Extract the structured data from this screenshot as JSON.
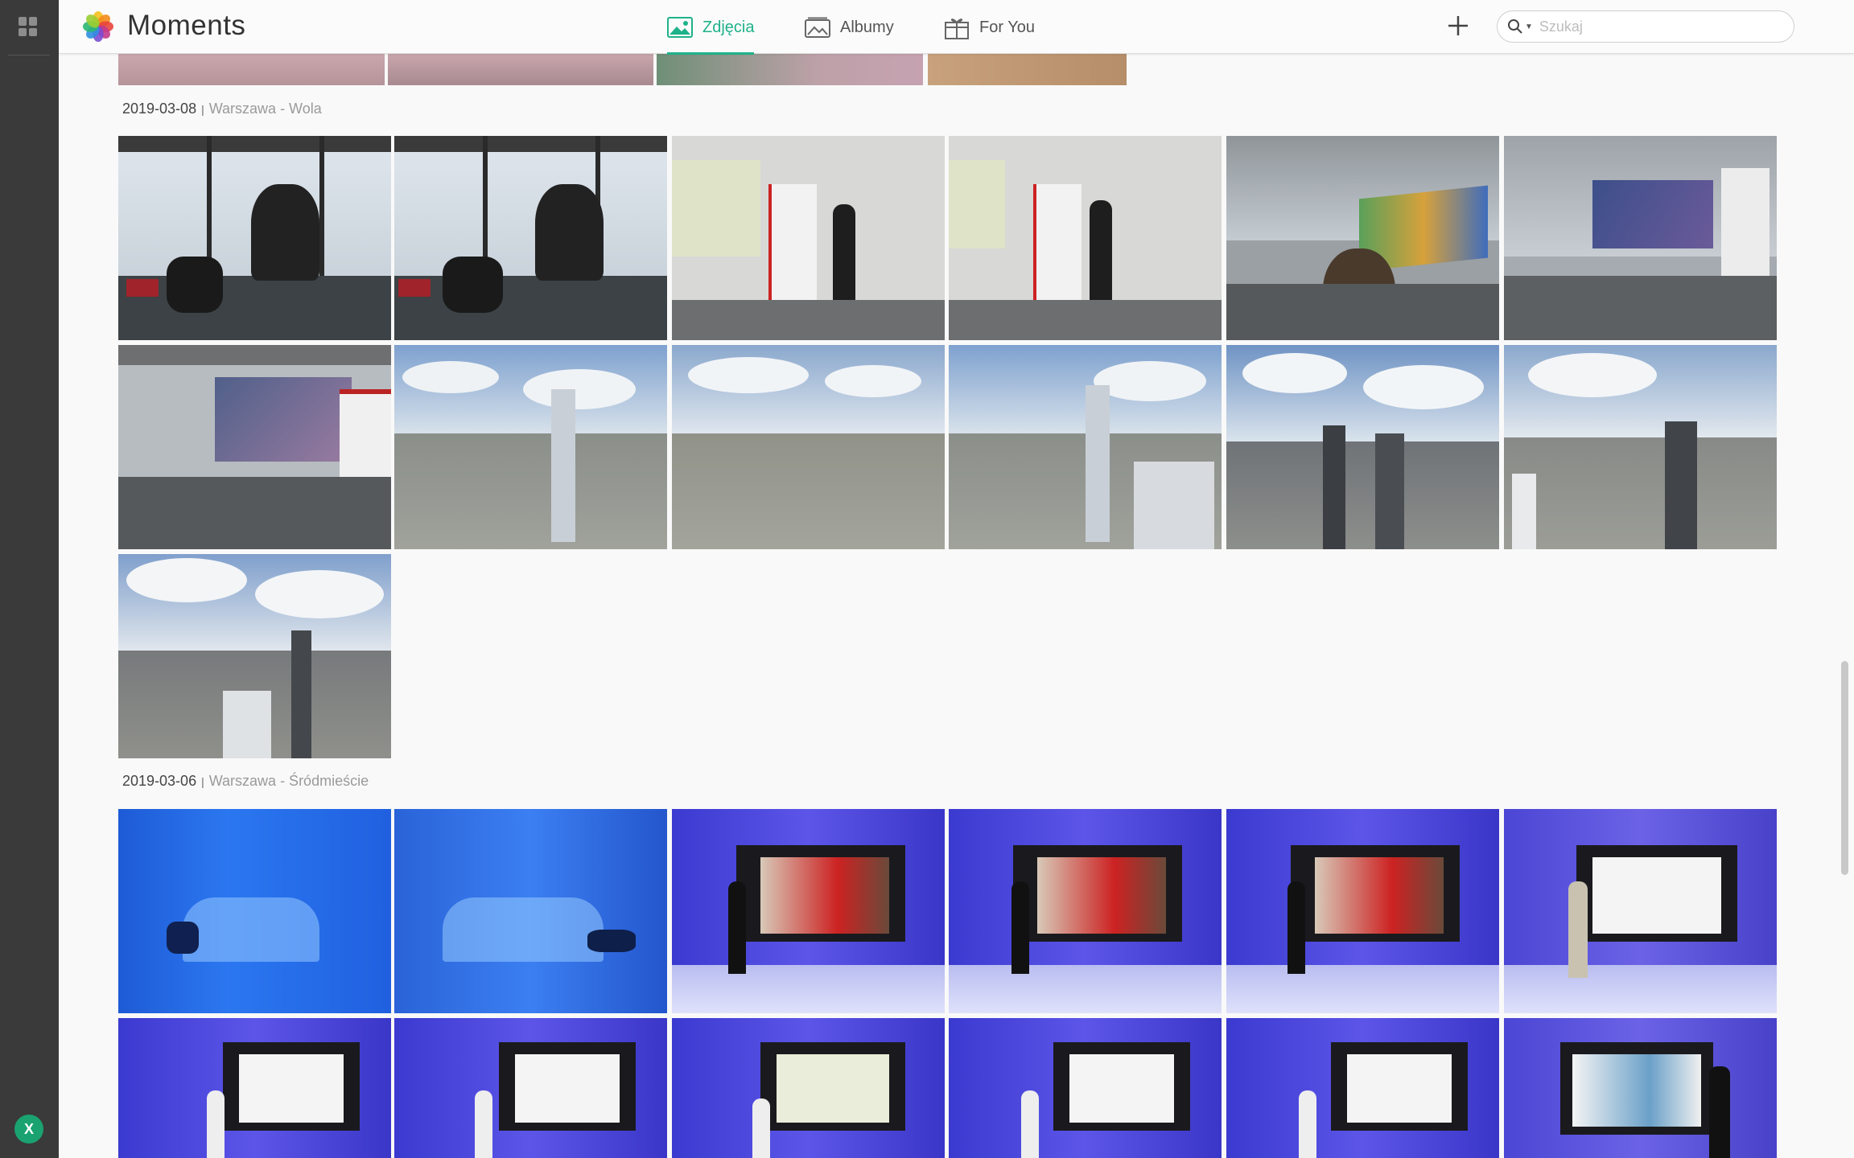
{
  "app": {
    "title": "Moments"
  },
  "nav": {
    "tabs": [
      {
        "label": "Zdjęcia",
        "icon": "photo-icon",
        "active": true
      },
      {
        "label": "Albumy",
        "icon": "album-icon",
        "active": false
      },
      {
        "label": "For You",
        "icon": "gift-icon",
        "active": false
      }
    ]
  },
  "search": {
    "placeholder": "Szukaj",
    "value": ""
  },
  "user": {
    "avatar_initial": "X"
  },
  "sections": [
    {
      "date": "2019-03-08",
      "location": "Warszawa - Wola",
      "photo_count": 13
    },
    {
      "date": "2019-03-06",
      "location": "Warszawa - Śródmieście",
      "photo_count": 12
    }
  ],
  "colors": {
    "accent": "#1fb28a",
    "rail": "#3a3a3a",
    "avatar": "#1aa371"
  }
}
